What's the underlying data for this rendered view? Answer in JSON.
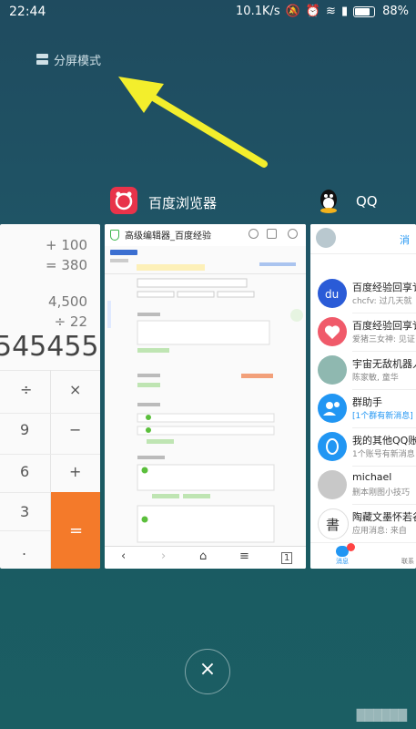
{
  "status": {
    "time": "22:44",
    "speed": "10.1K/s",
    "battery": "88%"
  },
  "split_mode": {
    "label": "分屏模式"
  },
  "apps": {
    "browser": {
      "name": "百度浏览器",
      "tab_title": "高级编辑器_百度经验",
      "brand_color": "#e8334a"
    },
    "qq": {
      "name": "QQ"
    }
  },
  "calculator": {
    "lines": [
      "+ 100",
      "= 380",
      "4,500",
      "÷ 22"
    ],
    "result": "545455",
    "keys": [
      "÷",
      "×",
      "9",
      "−",
      "6",
      "+",
      "3",
      "=",
      "."
    ],
    "accent": "#f47a2a"
  },
  "qq_panel": {
    "header_action": "消",
    "conversations": [
      {
        "name": "百度经验回享讠",
        "preview": "chcfv: 过几天就",
        "color": "#2a5bd7",
        "icon": "du"
      },
      {
        "name": "百度经验回享讠",
        "preview": "爱猪三女神: 见证",
        "color": "#f05a6a",
        "icon": "heart"
      },
      {
        "name": "宇宙无敌机器人",
        "preview": "陈家敏, 童华",
        "color": "#8fb8b0",
        "icon": "avatar"
      },
      {
        "name": "群助手",
        "preview": "[1个群有新消息]",
        "color": "#2196f3",
        "icon": "group"
      },
      {
        "name": "我的其他QQ账",
        "preview": "1个账号有新消息",
        "color": "#2196f3",
        "icon": "qq"
      },
      {
        "name": "michael",
        "preview": "删本刚图小技巧",
        "color": "#c8c8c8",
        "icon": "avatar"
      },
      {
        "name": "陶藏文墨怀若谷",
        "preview": "应用消息: 来自",
        "color": "#ffffff",
        "icon": "calligraphy"
      }
    ],
    "footer": {
      "messages": "消息",
      "contacts": "联系"
    }
  },
  "close_button": {
    "glyph": "×"
  },
  "watermark": "██████"
}
